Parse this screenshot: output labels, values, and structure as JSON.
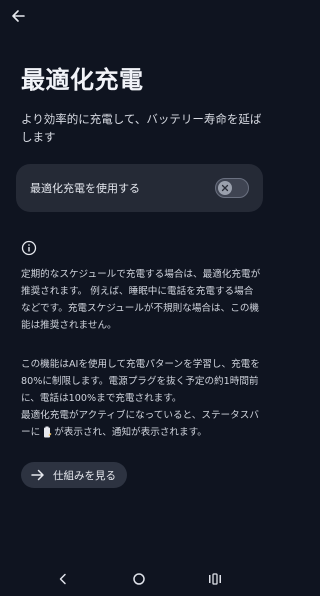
{
  "header": {
    "back_icon": "arrow-left-icon",
    "title": "最適化充電",
    "subtitle": "より効率的に充電して、バッテリー寿命を延ばします"
  },
  "toggle": {
    "label": "最適化充電を使用する",
    "state": "off"
  },
  "info": {
    "icon": "info-icon",
    "paragraph1": "定期的なスケジュールで充電する場合は、最適化充電が推奨されます。 例えば、睡眠中に電話を充電する場合などです。充電スケジュールが不規則な場合は、この機能は推奨されません。",
    "paragraph2_line1": "この機能はAIを使用して充電パターンを学習し、充電を80%に制限します。電源プラグを抜く予定の約1時間前に、電話は100%まで充電されます。",
    "paragraph2_line2_before": "最適化充電がアクティブになっていると、ステータスバーに",
    "paragraph2_line2_after": "が表示され、通知が表示されます。"
  },
  "learn_more": {
    "label": "仕組みを見る",
    "icon": "arrow-right-icon"
  },
  "navbar": {
    "back_icon": "nav-back-icon",
    "home_icon": "nav-home-icon",
    "recents_icon": "nav-recents-icon"
  },
  "colors": {
    "background": "#0f1420",
    "card": "#252a36",
    "button": "#2d3341",
    "text": "#e7e9ef"
  }
}
